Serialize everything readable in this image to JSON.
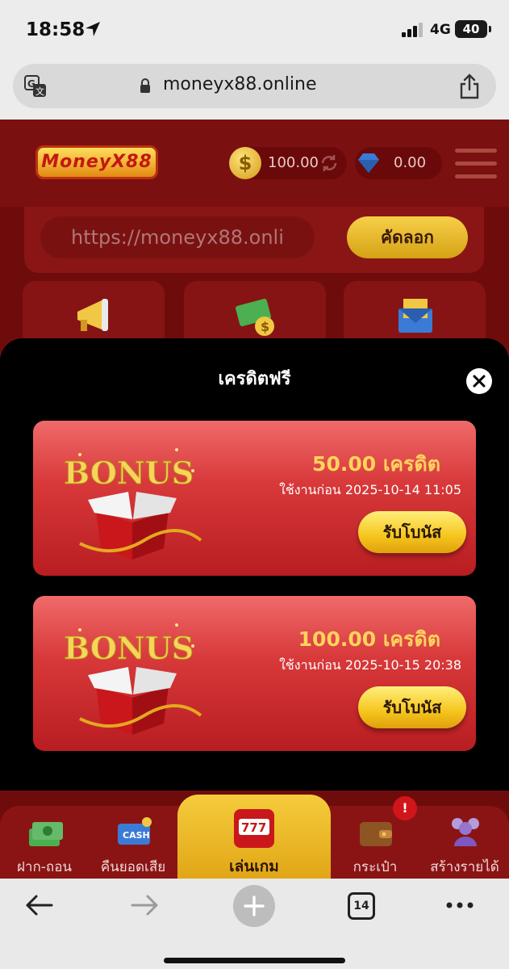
{
  "status_bar": {
    "time": "18:58",
    "network": "4G",
    "battery": "40"
  },
  "browser": {
    "url": "moneyx88.online",
    "open_tabs": "14"
  },
  "site": {
    "logo_text": "MoneyX88",
    "balance": "100.00",
    "points": "0.00",
    "referral_link": "https://moneyx88.onli",
    "copy_label": "คัดลอก"
  },
  "modal": {
    "title": "เครดิตฟรี",
    "bonuses": [
      {
        "amount": "50.00 เครดิต",
        "expiry": "ใช้งานก่อน 2025-10-14  11:05",
        "claim_label": "รับโบนัส"
      },
      {
        "amount": "100.00 เครดิต",
        "expiry": "ใช้งานก่อน 2025-10-15  20:38",
        "claim_label": "รับโบนัส"
      }
    ]
  },
  "bottom_nav": {
    "items": [
      {
        "label": "ฝาก-ถอน",
        "icon": "money-stack-icon"
      },
      {
        "label": "คืนยอดเสีย",
        "icon": "cashback-icon"
      },
      {
        "label": "เล่นเกม",
        "icon": "slot-machine-icon"
      },
      {
        "label": "กระเป๋า",
        "icon": "wallet-icon"
      },
      {
        "label": "สร้างรายได้",
        "icon": "referral-people-icon"
      }
    ],
    "wallet_badge": "!"
  },
  "colors": {
    "modal_bg": "#000000",
    "card_red": "#d8393a",
    "gold": "#ffd35c",
    "site_red": "#7b1010"
  }
}
